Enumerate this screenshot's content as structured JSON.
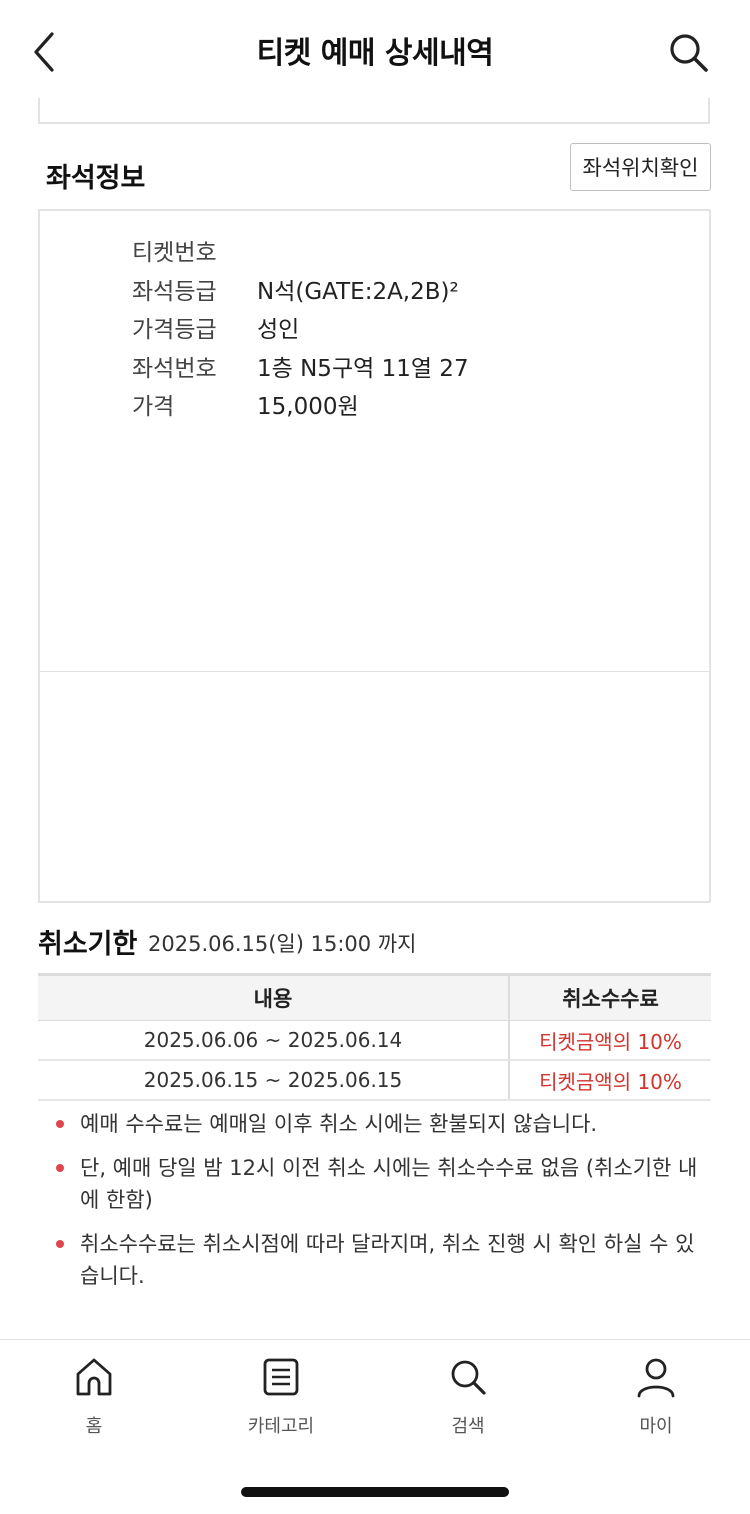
{
  "header": {
    "title": "티켓 예매 상세내역",
    "back_icon": "chevron-left-icon",
    "search_icon": "search-icon"
  },
  "seat_info": {
    "title": "좌석정보",
    "seat_map_button": "좌석위치확인",
    "rows": [
      {
        "label": "티켓번호",
        "value": ""
      },
      {
        "label": "좌석등급",
        "value": "N석(GATE:2A,2B)²"
      },
      {
        "label": "가격등급",
        "value": "성인"
      },
      {
        "label": "좌석번호",
        "value": "1층 N5구역 11열 27"
      },
      {
        "label": "가격",
        "value": "15,000원"
      }
    ]
  },
  "cancel": {
    "title": "취소기한",
    "deadline": "2025.06.15(일) 15:00 까지",
    "table": {
      "headers": [
        "내용",
        "취소수수료"
      ],
      "rows": [
        [
          "2025.06.06 ~ 2025.06.14",
          "티켓금액의 10%"
        ],
        [
          "2025.06.15 ~ 2025.06.15",
          "티켓금액의 10%"
        ]
      ]
    },
    "notes": [
      "예매 수수료는 예매일 이후 취소 시에는 환불되지 않습니다.",
      "단, 예매 당일 밤 12시 이전 취소 시에는 취소수수료 없음 (취소기한 내에 한함)",
      "취소수수료는 취소시점에 따라 달라지며, 취소 진행 시 확인 하실 수 있습니다."
    ]
  },
  "tabbar": {
    "items": [
      {
        "label": "홈",
        "icon": "home-icon"
      },
      {
        "label": "카테고리",
        "icon": "list-icon"
      },
      {
        "label": "검색",
        "icon": "search-icon"
      },
      {
        "label": "마이",
        "icon": "user-icon"
      }
    ]
  },
  "colors": {
    "accent_red": "#d0342c",
    "bullet_red": "#e0474c"
  }
}
